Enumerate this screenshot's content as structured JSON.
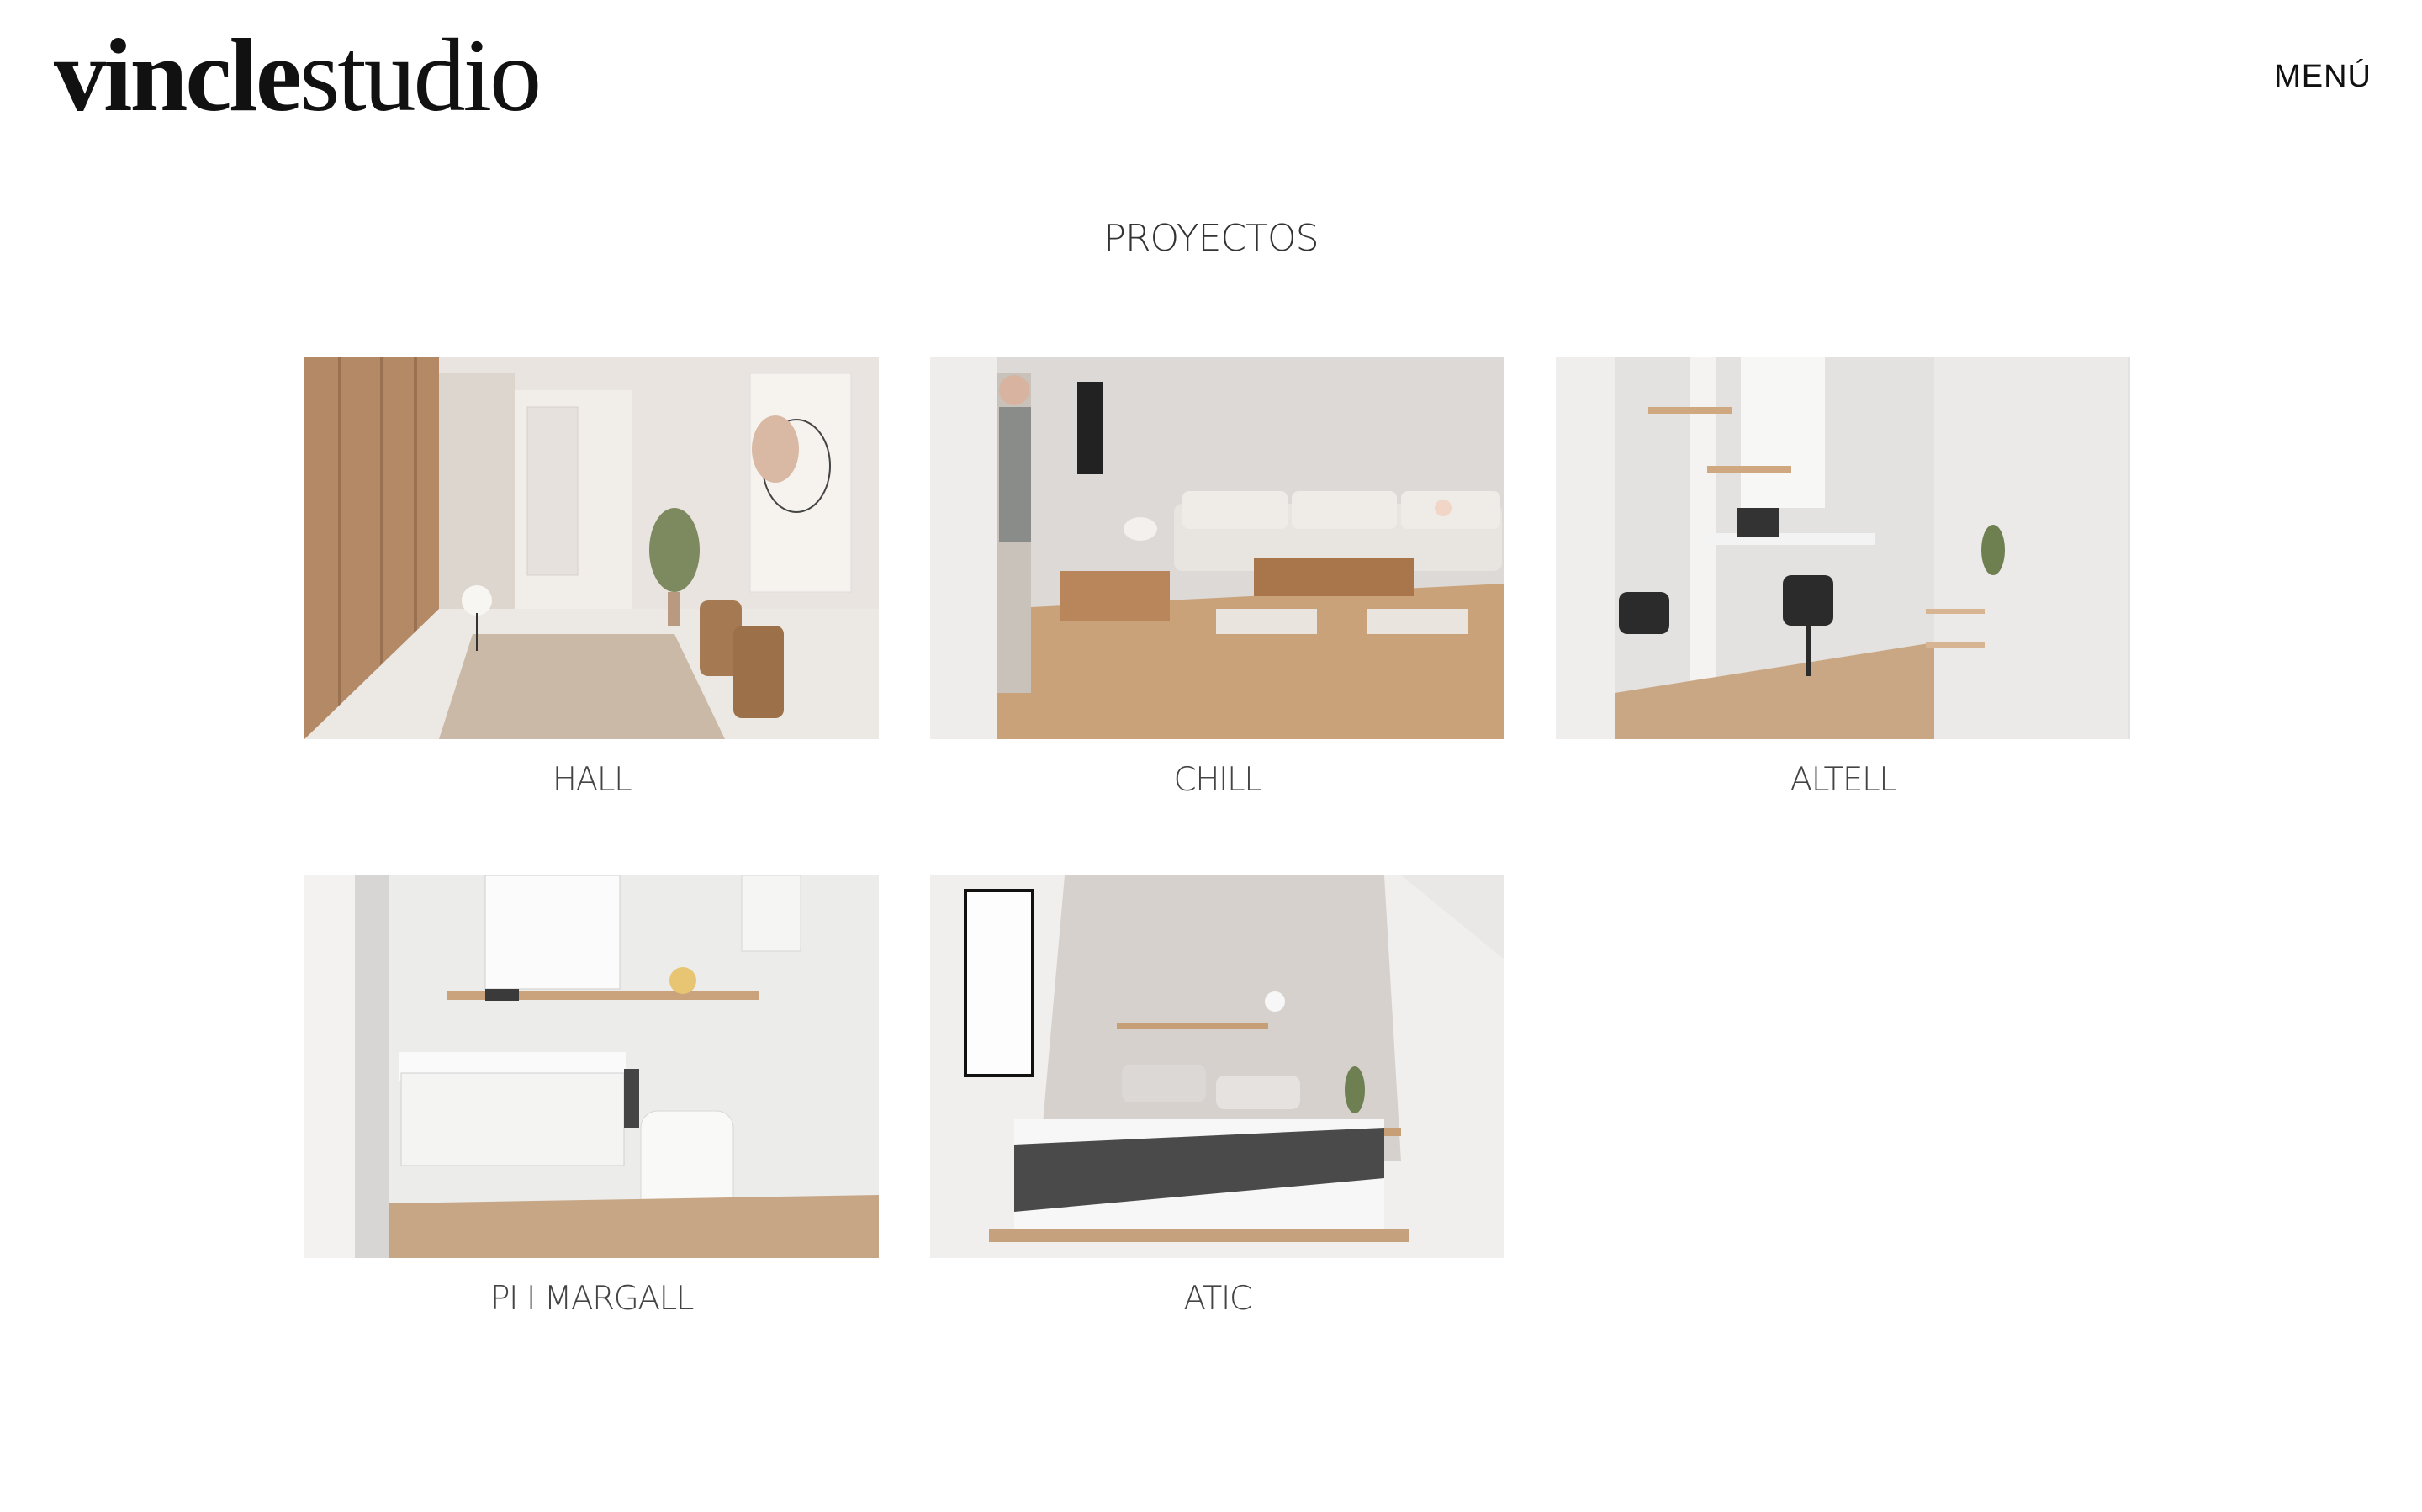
{
  "header": {
    "logo_bold": "vincle",
    "logo_light": "studio",
    "menu_label": "MENÚ"
  },
  "main": {
    "title": "PROYECTOS",
    "projects": [
      {
        "label": "HALL",
        "image": "hallway-interior-render"
      },
      {
        "label": "CHILL",
        "image": "living-room-interior-render"
      },
      {
        "label": "ALTELL",
        "image": "home-office-interior-render"
      },
      {
        "label": "PI I MARGALL",
        "image": "bathroom-interior-render"
      },
      {
        "label": "ATIC",
        "image": "attic-bedroom-interior-render"
      }
    ]
  }
}
